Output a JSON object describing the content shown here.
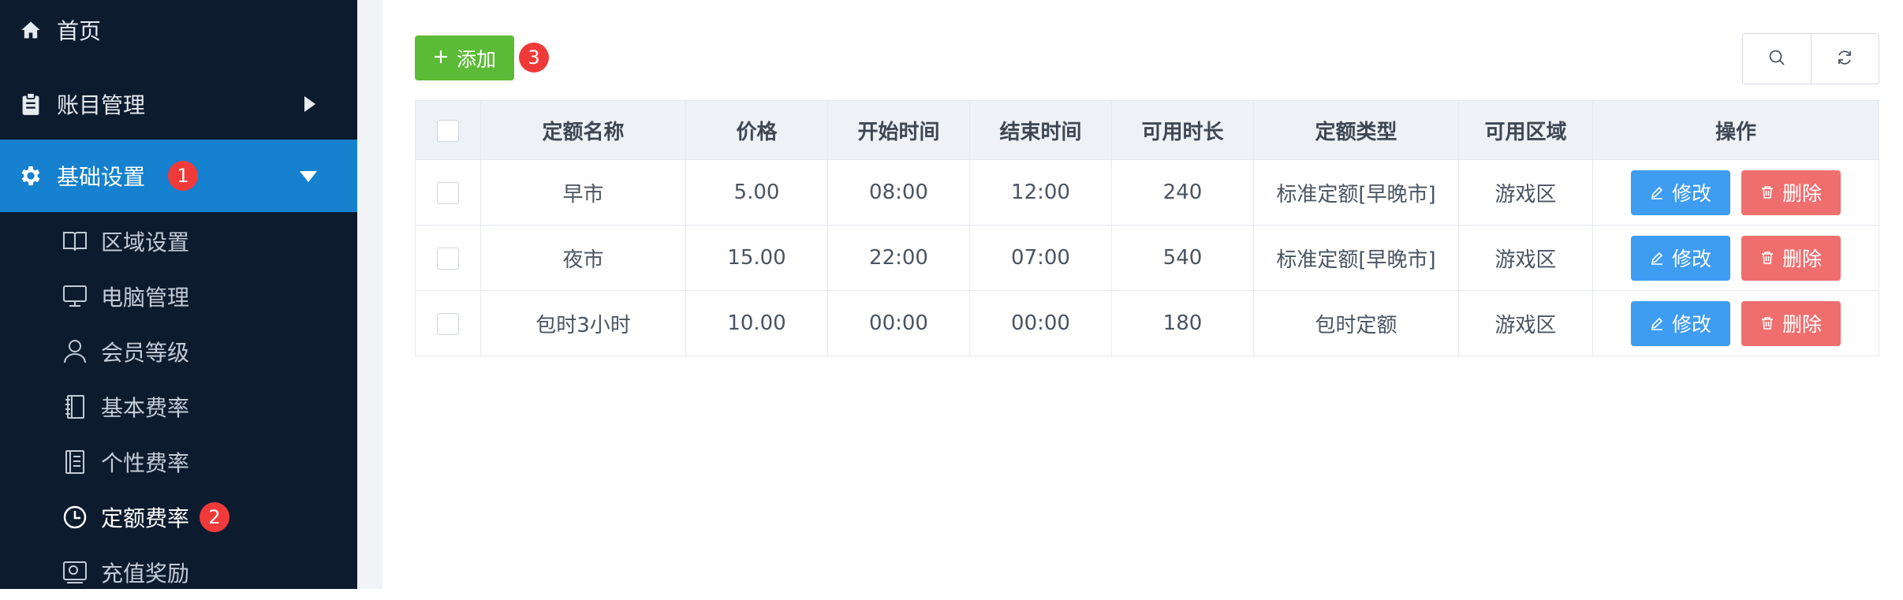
{
  "sidebar": {
    "items": [
      {
        "label": "首页",
        "icon": "home-icon"
      },
      {
        "label": "账目管理",
        "icon": "clipboard-icon"
      },
      {
        "label": "基础设置",
        "icon": "gear-icon",
        "badge": "1"
      }
    ],
    "submenu": [
      {
        "label": "区域设置",
        "icon": "book-icon"
      },
      {
        "label": "电脑管理",
        "icon": "monitor-icon"
      },
      {
        "label": "会员等级",
        "icon": "user-icon"
      },
      {
        "label": "基本费率",
        "icon": "notebook-icon"
      },
      {
        "label": "个性费率",
        "icon": "document-icon"
      },
      {
        "label": "定额费率",
        "icon": "clock-icon",
        "badge": "2"
      },
      {
        "label": "充值奖励",
        "icon": "reward-icon"
      }
    ]
  },
  "toolbar": {
    "add_label": "添加",
    "add_badge": "3"
  },
  "table": {
    "headers": [
      "定额名称",
      "价格",
      "开始时间",
      "结束时间",
      "可用时长",
      "定额类型",
      "可用区域",
      "操作"
    ],
    "rows": [
      [
        "早市",
        "5.00",
        "08:00",
        "12:00",
        "240",
        "标准定额[早晚市]",
        "游戏区"
      ],
      [
        "夜市",
        "15.00",
        "22:00",
        "07:00",
        "540",
        "标准定额[早晚市]",
        "游戏区"
      ],
      [
        "包时3小时",
        "10.00",
        "00:00",
        "00:00",
        "180",
        "包时定额",
        "游戏区"
      ]
    ],
    "edit_label": "修改",
    "delete_label": "删除"
  },
  "colors": {
    "sidebar_bg": "#0d1b2e",
    "active_menu": "#1681ce",
    "add_button": "#5cbb36",
    "edit_button": "#3e9cf1",
    "delete_button": "#ef6f6f",
    "badge": "#f03a3a"
  }
}
